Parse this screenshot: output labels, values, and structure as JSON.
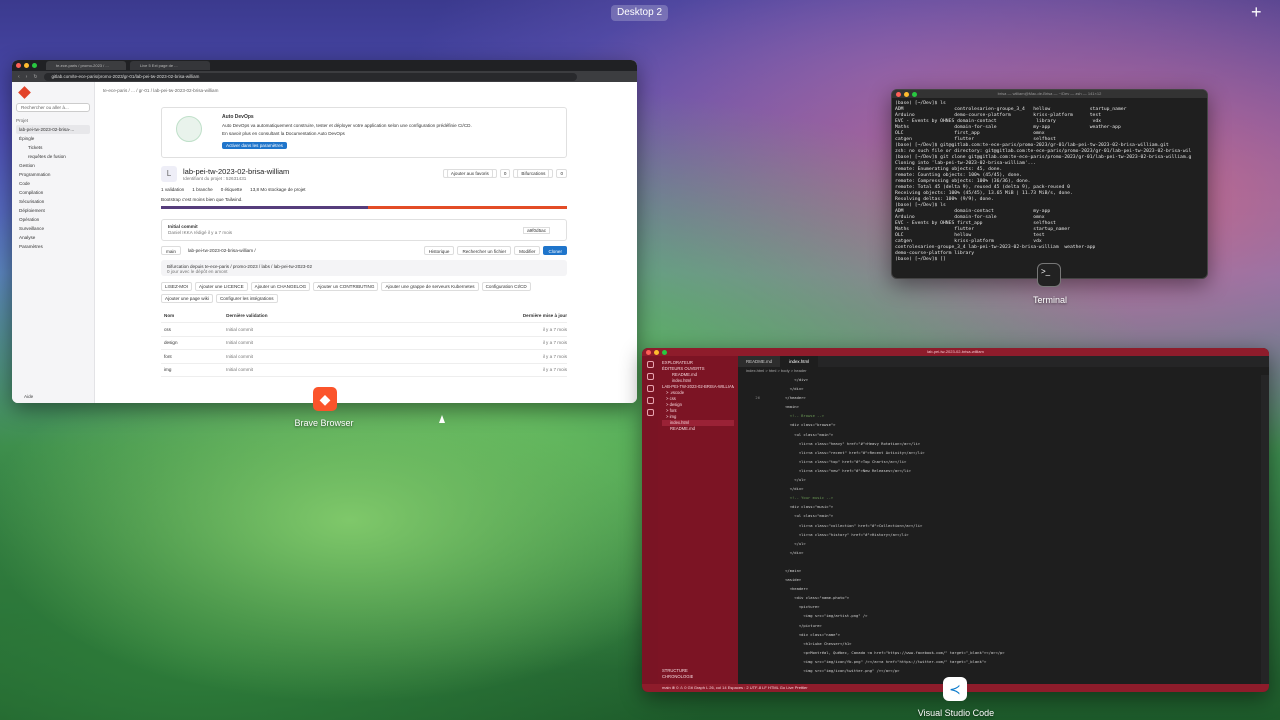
{
  "desktop": {
    "label": "Desktop 2",
    "add_symbol": "+"
  },
  "apps": {
    "browser": "Brave Browser",
    "terminal": "Terminal",
    "vscode": "Visual Studio Code"
  },
  "browser": {
    "tabs": [
      "te-ece-paris / promo-2023 / ...",
      "Live 5 Ext page de ..."
    ],
    "url": "gitlab.com/te-ece-paris/promo-2023/gr-01/lab-pei-tw-2023-02-brisa-william",
    "sidebar": {
      "search": "Rechercher ou aller à...",
      "section": "Projet",
      "items": [
        "lab-pei-tw-2023-02-brisa-...",
        "Épingle",
        "Tickets",
        "requêtes de fusion",
        "Gestion",
        "Programmation",
        "Code",
        "Compilation",
        "Sécurisation",
        "Déploiement",
        "Opération",
        "Surveillance",
        "Analyse",
        "Paramètres"
      ],
      "help": "Aide"
    },
    "crumb": "te-ece-paris / ... / gr-01 / lab-pei-tw-2023-02-brisa-william",
    "devops": {
      "title": "Auto DevOps",
      "text": "Auto DevOps va automatiquement construire, tester et déployer votre application selon une configuration prédéfinie CI/CD.",
      "more": "En savoir plus en consultant la Documentation Auto DevOps",
      "button": "Activer dans les paramètres"
    },
    "project": {
      "avatar": "L",
      "name": "lab-pei-tw-2023-02-brisa-william",
      "id": "Identifiant du projet : 52631431",
      "star": "Ajouter aux favoris",
      "star_count": "0",
      "forks": "Bifurcations",
      "forks_count": "0",
      "stats": [
        "1 validation",
        "1 branche",
        "0 étiquette",
        "13,8 Mo stockage de projet"
      ],
      "description": "Bootstrap c'est moins bien que Tailwind."
    },
    "commit": {
      "title": "Initial commit",
      "author": "Daniel IKKA rédigé il y a 7 mois",
      "sha": "a9f0d5ac"
    },
    "toolbar": {
      "branch": "main",
      "path": "lab-pei-tw-2023-02-brisa-william /",
      "history": "Historique",
      "find": "Rechercher un fichier",
      "edit": "Modifier",
      "clone": "Cloner"
    },
    "fork_info": {
      "line1": "Bifurcation depuis te-ece-paris / promo-2023 / labs / lab-pei-tw-2023-02",
      "line2": "0 jour avec le dépôt en amont"
    },
    "chips": [
      "LISEZ-MOI",
      "Ajouter une LICENCE",
      "Ajouter un CHANGELOG",
      "Ajouter un CONTRIBUTING",
      "Ajouter une grappe de serveurs Kubernetes",
      "Configuration CI/CD",
      "Ajouter une page wiki",
      "Configurer les intégrations"
    ],
    "table": {
      "headers": [
        "Nom",
        "Dernière validation",
        "Dernière mise à jour"
      ],
      "rows": [
        [
          "css",
          "Initial commit",
          "il y a 7 mois"
        ],
        [
          "design",
          "Initial commit",
          "il y a 7 mois"
        ],
        [
          "font",
          "Initial commit",
          "il y a 7 mois"
        ],
        [
          "img",
          "Initial commit",
          "il y a 7 mois"
        ]
      ]
    }
  },
  "terminal": {
    "title": "brisa — william@Mac-de-Brisa — ~/Dev — zsh — 141×12",
    "lines": [
      "(base) [~/Dev]$ ls",
      "ADM                  controlesarien-groupe_3_4   hellow              startup_namer",
      "Arduino              demo-course-platform        kriss-platform      test",
      "EVC - Events by OHNES domain-contact              library             vdx",
      "Maths                domain-for-sale             my-app              weather-app",
      "OLC                  first_app                   omnx",
      "catgen               flutter                     selfhost",
      "(base) [~/Dev]$ git@gitlab.com:te-ece-paris/promo-2023/gr-01/lab-pei-tw-2023-02-brisa-william.git",
      "zsh: no such file or directory: git@gitlab.com:te-ece-paris/promo-2023/gr-01/lab-pei-tw-2023-02-brisa-wil",
      "(base) [~/Dev]$ git clone git@gitlab.com:te-ece-paris/promo-2023/gr-01/lab-pei-tw-2023-02-brisa-william.g",
      "Cloning into 'lab-pei-tw-2023-02-brisa-william'...",
      "remote: Enumerating objects: 45, done.",
      "remote: Counting objects: 100% (45/45), done.",
      "remote: Compressing objects: 100% (36/36), done.",
      "remote: Total 45 (delta 9), reused 45 (delta 9), pack-reused 0",
      "Receiving objects: 100% (45/45), 13.65 MiB | 11.73 MiB/s, done.",
      "Resolving deltas: 100% (9/9), done.",
      "(base) [~/Dev]$ ls",
      "ADM                  domain-contact              my-app",
      "Arduino              domain-for-sale             omnx",
      "EVC - Events by OHNES first_app                  selfhost",
      "Maths                flutter                     startup_namer",
      "OLC                  hellow                      test",
      "catgen               kriss-platform              vdx",
      "controlesarien-groupe_3_4 lab-pei-tw-2023-02-brisa-william  weather-app",
      "demo-course-platform library",
      "(base) [~/Dev]$ []"
    ]
  },
  "vscode": {
    "title": "lab-pei-tw-2023-02-brisa-william",
    "explorer_title": "EXPLORATEUR",
    "tree": [
      "ÉDITEURS OUVERTS",
      "README.md",
      "index.html",
      "LAB-PEI-TW-2023-02-BRISA-WILLIAM",
      "> .vscode",
      "> css",
      "> design",
      "> font",
      "> img",
      "index.html",
      "README.md"
    ],
    "bottom_sections": [
      "STRUCTURE",
      "CHRONOLOGIE"
    ],
    "tabs": [
      "README.md",
      "index.html"
    ],
    "breadcrumb": "index.html > html > body > header",
    "code": [
      [
        "",
        "        </div>"
      ],
      [
        "",
        "      </div>"
      ],
      [
        "26",
        "    </header>"
      ],
      [
        "",
        "    <main>"
      ],
      [
        "",
        "      <!-- Browse -->"
      ],
      [
        "",
        "      <div class=\"browse\">"
      ],
      [
        "",
        "        <ul class=\"main\">"
      ],
      [
        "",
        "          <li><a class=\"heavy\" href=\"#\">Heavy Rotation</a></li>"
      ],
      [
        "",
        "          <li><a class=\"recent\" href=\"#\">Recent Activity</a></li>"
      ],
      [
        "",
        "          <li><a class=\"top\" href=\"#\">Top Charts</a></li>"
      ],
      [
        "",
        "          <li><a class=\"new\" href=\"#\">New Releases</a></li>"
      ],
      [
        "",
        "        </ul>"
      ],
      [
        "",
        "      </div>"
      ],
      [
        "",
        "      <!-- Your music -->"
      ],
      [
        "",
        "      <div class=\"music\">"
      ],
      [
        "",
        "        <ul class=\"main\">"
      ],
      [
        "",
        "          <li><a class=\"collection\" href=\"#\">Collection</a></li>"
      ],
      [
        "",
        "          <li><a class=\"history\" href=\"#\">History</a></li>"
      ],
      [
        "",
        "        </ul>"
      ],
      [
        "",
        "      </div>"
      ],
      [
        "",
        ""
      ],
      [
        "",
        "    </main>"
      ],
      [
        "",
        "    <aside>"
      ],
      [
        "",
        "      <header>"
      ],
      [
        "",
        "        <div class=\"name-photo\">"
      ],
      [
        "",
        "          <picture>"
      ],
      [
        "",
        "            <img src=\"img/artist.png\" />"
      ],
      [
        "",
        "          </picture>"
      ],
      [
        "",
        "          <div class=\"name\">"
      ],
      [
        "",
        "            <h1>Luke Chesser</h1>"
      ],
      [
        "",
        "            <p>Montréal, Québec, Canada <a href=\"https://www.facebook.com/\" target=\"_blank\"></a></p>"
      ],
      [
        "",
        "            <img src=\"img/icon/fb.png\" /></a><a href=\"https://twitter.com/\" target=\"_blank\">"
      ],
      [
        "",
        "            <img src=\"img/icon/twitter.png\" /></a></p>"
      ]
    ],
    "status": "main  ⊗ 0 ⚠ 0  Git Graph          L 26, col 14   Espaces : 2   UTF-8   LF   HTML   Go Live   Prettier"
  }
}
